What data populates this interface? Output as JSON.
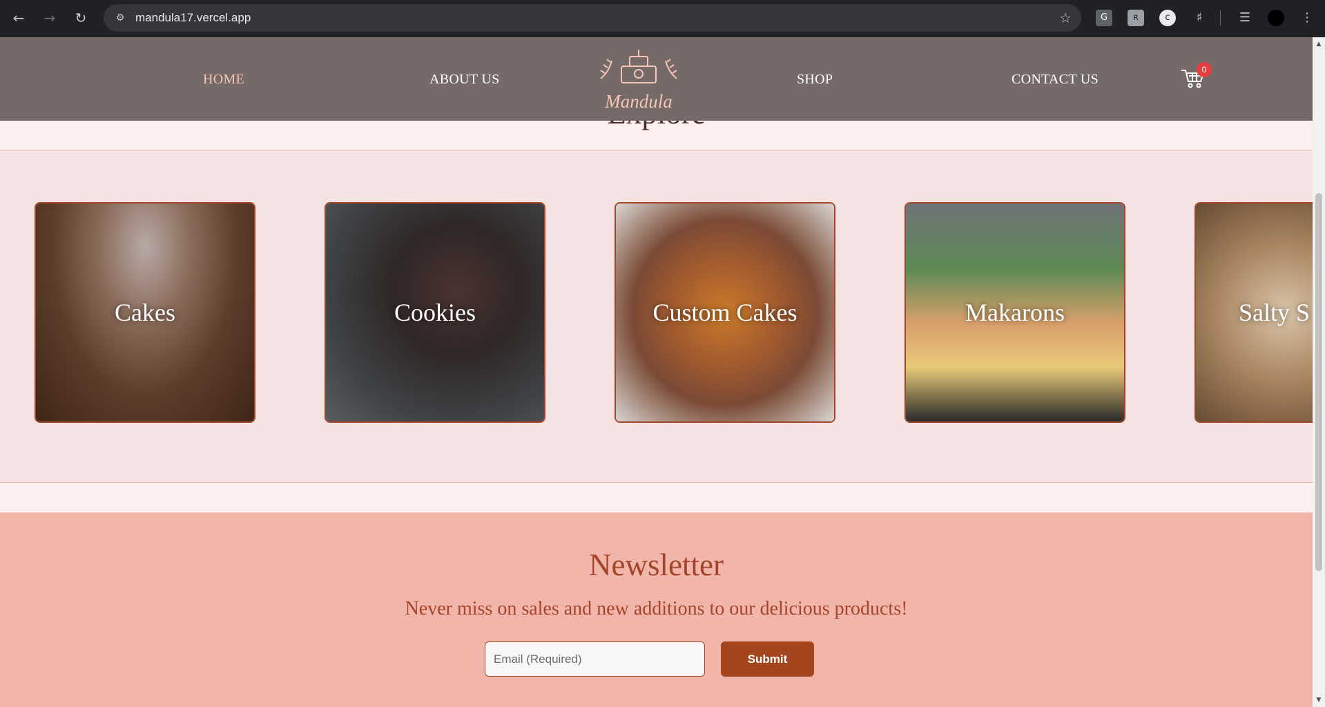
{
  "browser": {
    "url": "mandula17.vercel.app",
    "back_icon": "arrow-left-icon",
    "forward_icon": "arrow-right-icon",
    "reload_icon": "reload-icon",
    "extensions": [
      "G",
      "ʀ",
      "c"
    ]
  },
  "header": {
    "nav": {
      "home": "HOME",
      "about": "ABOUT US",
      "shop": "SHOP",
      "contact": "CONTACT US"
    },
    "logo_text": "Mandula",
    "cart_count": "0"
  },
  "explore": {
    "title": "Explore",
    "categories": [
      {
        "label": "Cakes"
      },
      {
        "label": "Cookies"
      },
      {
        "label": "Custom Cakes"
      },
      {
        "label": "Makarons"
      },
      {
        "label": "Salty S"
      }
    ]
  },
  "newsletter": {
    "title": "Newsletter",
    "subtitle": "Never miss on sales and new additions to our delicious products!",
    "email_placeholder": "Email (Required)",
    "submit_label": "Submit"
  },
  "colors": {
    "header_bg": "#766a69",
    "accent": "#a4452a",
    "active_nav": "#f7c4b4",
    "newsletter_bg": "#f1b5aa"
  }
}
